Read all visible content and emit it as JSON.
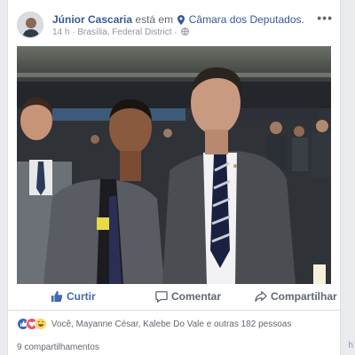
{
  "post": {
    "author": "Júnior Cascaria",
    "verb": "está em",
    "place": "Câmara dos Deputados.",
    "time": "14 h",
    "location": "Brasília, Federal District",
    "separator": "·",
    "more": "•••",
    "privacy_icon": "globe-icon",
    "place_icon": "map-pin-icon"
  },
  "actions": {
    "like": "Curtir",
    "comment": "Comentar",
    "share": "Compartilhar"
  },
  "reactions": {
    "icons": [
      "like-icon",
      "love-icon",
      "haha-icon"
    ],
    "text": "Você, Mayanne César, Kalebe Do Vale e outras 182 pessoas"
  },
  "shares_text": "9 compartilhamentos",
  "corner_text": "h",
  "colors": {
    "link": "#365899",
    "like_blue": "#4267b2",
    "background": "#e9ebee"
  }
}
